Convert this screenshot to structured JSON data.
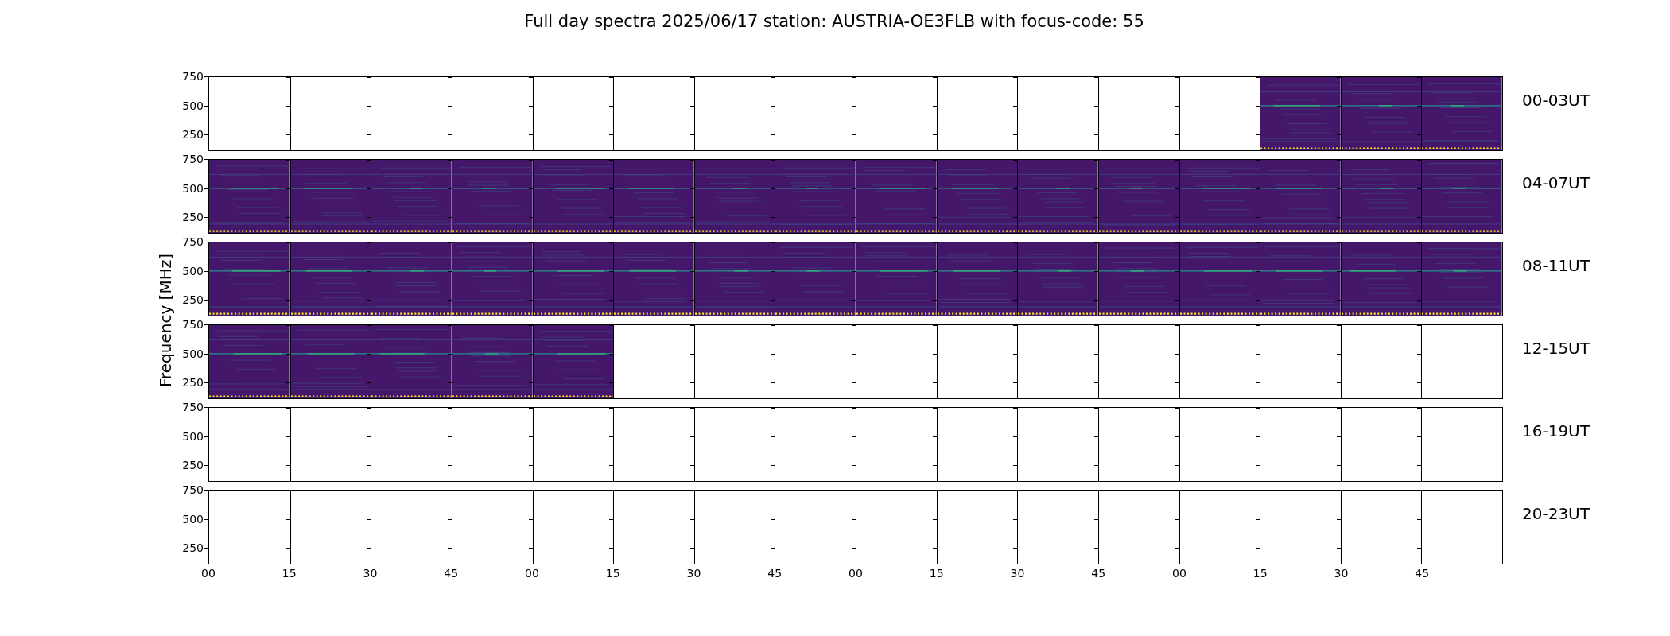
{
  "title": "Full day spectra 2025/06/17 station: AUSTRIA-OE3FLB with focus-code: 55",
  "y_axis_label": "Frequency [MHz]",
  "rows": [
    {
      "label": "00-03UT",
      "y_ticks": [
        "750",
        "500",
        "250"
      ],
      "panels": [
        {
          "has_data": false
        },
        {
          "has_data": false
        },
        {
          "has_data": false
        },
        {
          "has_data": false
        },
        {
          "has_data": false
        },
        {
          "has_data": false
        },
        {
          "has_data": false
        },
        {
          "has_data": false
        },
        {
          "has_data": false
        },
        {
          "has_data": false
        },
        {
          "has_data": false
        },
        {
          "has_data": false
        },
        {
          "has_data": false
        },
        {
          "has_data": true
        },
        {
          "has_data": true
        },
        {
          "has_data": true
        }
      ]
    },
    {
      "label": "04-07UT",
      "y_ticks": [
        "750",
        "500",
        "250"
      ],
      "panels": [
        {
          "has_data": true
        },
        {
          "has_data": true
        },
        {
          "has_data": true
        },
        {
          "has_data": true
        },
        {
          "has_data": true
        },
        {
          "has_data": true
        },
        {
          "has_data": true
        },
        {
          "has_data": true
        },
        {
          "has_data": true
        },
        {
          "has_data": true
        },
        {
          "has_data": true
        },
        {
          "has_data": true
        },
        {
          "has_data": true
        },
        {
          "has_data": true
        },
        {
          "has_data": true
        },
        {
          "has_data": true
        }
      ]
    },
    {
      "label": "08-11UT",
      "y_ticks": [
        "750",
        "500",
        "250"
      ],
      "panels": [
        {
          "has_data": true
        },
        {
          "has_data": true
        },
        {
          "has_data": true
        },
        {
          "has_data": true
        },
        {
          "has_data": true
        },
        {
          "has_data": true
        },
        {
          "has_data": true
        },
        {
          "has_data": true
        },
        {
          "has_data": true
        },
        {
          "has_data": true
        },
        {
          "has_data": true
        },
        {
          "has_data": true
        },
        {
          "has_data": true
        },
        {
          "has_data": true
        },
        {
          "has_data": true
        },
        {
          "has_data": true
        }
      ]
    },
    {
      "label": "12-15UT",
      "y_ticks": [
        "750",
        "500",
        "250"
      ],
      "panels": [
        {
          "has_data": true
        },
        {
          "has_data": true
        },
        {
          "has_data": true
        },
        {
          "has_data": true
        },
        {
          "has_data": true
        },
        {
          "has_data": false
        },
        {
          "has_data": false
        },
        {
          "has_data": false
        },
        {
          "has_data": false
        },
        {
          "has_data": false
        },
        {
          "has_data": false
        },
        {
          "has_data": false
        },
        {
          "has_data": false
        },
        {
          "has_data": false
        },
        {
          "has_data": false
        },
        {
          "has_data": false
        }
      ]
    },
    {
      "label": "16-19UT",
      "y_ticks": [
        "750",
        "500",
        "250"
      ],
      "panels": [
        {
          "has_data": false
        },
        {
          "has_data": false
        },
        {
          "has_data": false
        },
        {
          "has_data": false
        },
        {
          "has_data": false
        },
        {
          "has_data": false
        },
        {
          "has_data": false
        },
        {
          "has_data": false
        },
        {
          "has_data": false
        },
        {
          "has_data": false
        },
        {
          "has_data": false
        },
        {
          "has_data": false
        },
        {
          "has_data": false
        },
        {
          "has_data": false
        },
        {
          "has_data": false
        },
        {
          "has_data": false
        }
      ]
    },
    {
      "label": "20-23UT",
      "y_ticks": [
        "750",
        "500",
        "250"
      ],
      "panels": [
        {
          "has_data": false
        },
        {
          "has_data": false
        },
        {
          "has_data": false
        },
        {
          "has_data": false
        },
        {
          "has_data": false
        },
        {
          "has_data": false
        },
        {
          "has_data": false
        },
        {
          "has_data": false
        },
        {
          "has_data": false
        },
        {
          "has_data": false
        },
        {
          "has_data": false
        },
        {
          "has_data": false
        },
        {
          "has_data": false
        },
        {
          "has_data": false
        },
        {
          "has_data": false
        },
        {
          "has_data": false
        }
      ]
    }
  ],
  "x_ticks": [
    "00",
    "15",
    "30",
    "45",
    "00",
    "15",
    "30",
    "45",
    "00",
    "15",
    "30",
    "45",
    "00",
    "15",
    "30",
    "45"
  ]
}
